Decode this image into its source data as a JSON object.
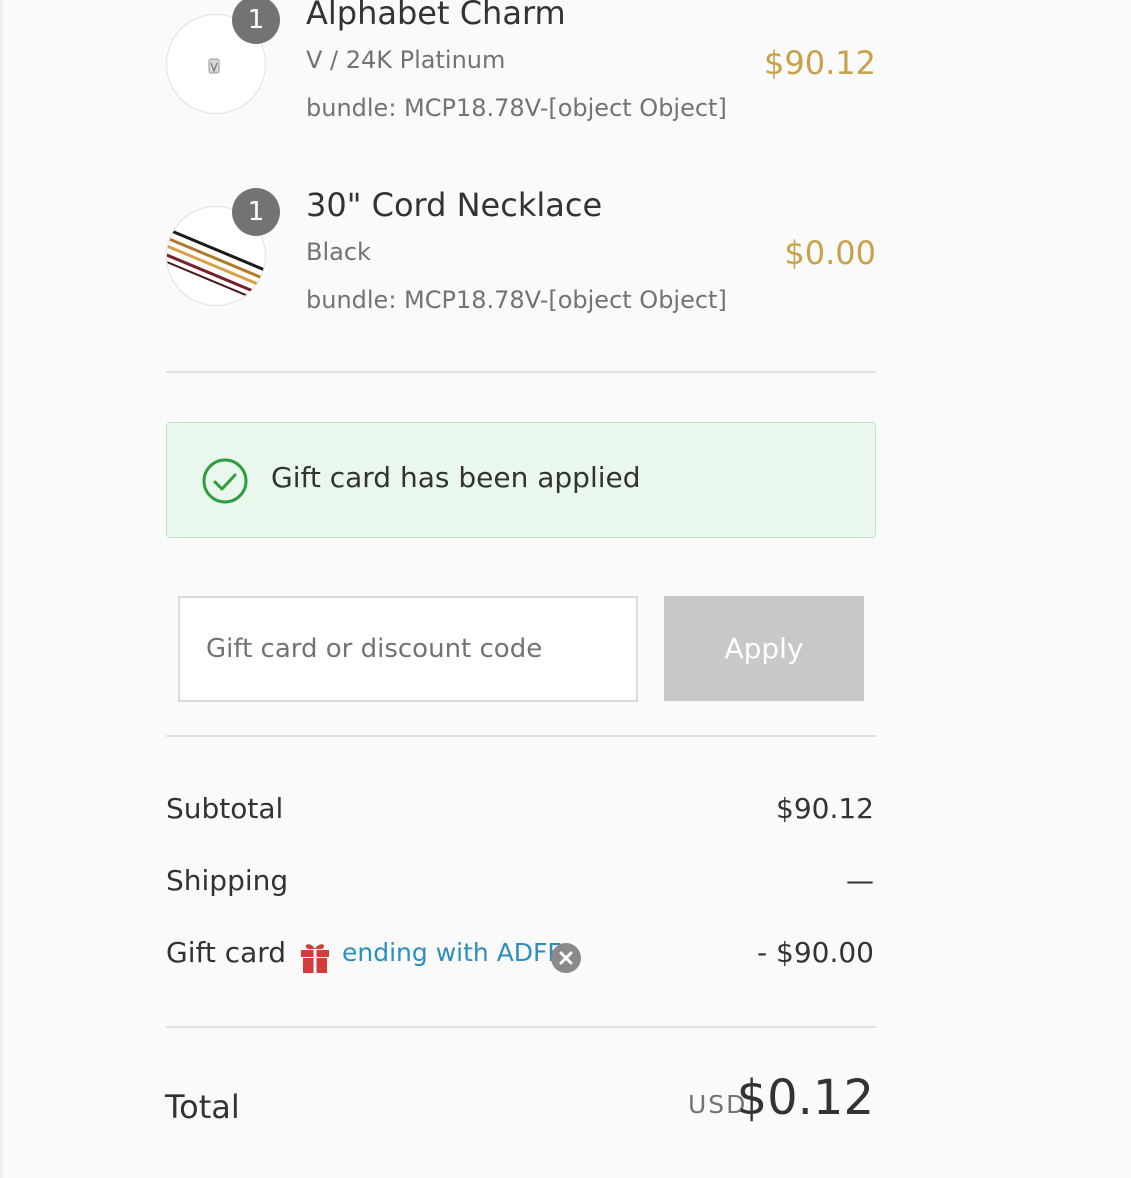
{
  "line_items": [
    {
      "quantity": "1",
      "name": "Alphabet Charm",
      "variant": "V / 24K Platinum",
      "bundle": "bundle: MCP18.78V-[object Object]",
      "price": "$90.12"
    },
    {
      "quantity": "1",
      "name": "30\" Cord Necklace",
      "variant": "Black",
      "bundle": "bundle: MCP18.78V-[object Object]",
      "price": "$0.00"
    }
  ],
  "notice": {
    "text": "Gift card has been applied",
    "icon": "check-circle-icon"
  },
  "discount": {
    "placeholder": "Gift card or discount code",
    "value": "",
    "button_label": "Apply"
  },
  "summary": {
    "subtotal_label": "Subtotal",
    "subtotal_value": "$90.12",
    "shipping_label": "Shipping",
    "shipping_value": "—",
    "giftcard_label": "Gift card",
    "giftcard_code": "ending with ADFF",
    "giftcard_value": "- $90.00"
  },
  "total": {
    "label": "Total",
    "currency": "USD",
    "amount": "$0.12"
  },
  "colors": {
    "price_accent": "#c9a14a",
    "success_bg": "#e9f7ec",
    "success_icon": "#2e9e3e",
    "link": "#2c8ebf",
    "gift_icon": "#d43c3c",
    "badge": "#737373",
    "button_disabled": "#c8c8c8"
  }
}
